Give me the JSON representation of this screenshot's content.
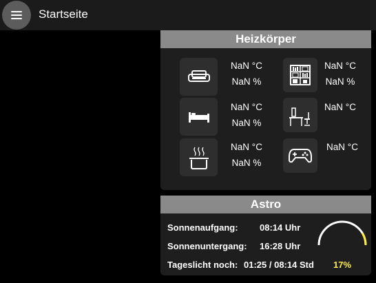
{
  "appbar": {
    "title": "Startseite",
    "menu_icon": "hamburger-menu-icon"
  },
  "heizkoerper": {
    "title": "Heizkörper",
    "rooms": [
      {
        "icon": "sofa-icon",
        "temperature": "NaN °C",
        "humidity": "NaN %"
      },
      {
        "icon": "bookshelf-icon",
        "temperature": "NaN °C",
        "humidity": "NaN %"
      },
      {
        "icon": "bed-icon",
        "temperature": "NaN °C",
        "humidity": "NaN %"
      },
      {
        "icon": "desk-chair-icon",
        "temperature": "NaN °C"
      },
      {
        "icon": "cooking-pot-icon",
        "temperature": "NaN °C",
        "humidity": "NaN %"
      },
      {
        "icon": "gamepad-icon",
        "temperature": "NaN °C"
      }
    ]
  },
  "astro": {
    "title": "Astro",
    "sunrise_label": "Sonnenaufgang:",
    "sunrise_value": "08:14 Uhr",
    "sunset_label": "Sonnenuntergang:",
    "sunset_value": "16:28 Uhr",
    "daylight_label": "Tageslicht noch:",
    "daylight_value": "01:25 / 08:14 Std",
    "daylight_percent": "17%",
    "daylight_fraction": 0.17,
    "gauge_color": "#ffeb3b"
  }
}
